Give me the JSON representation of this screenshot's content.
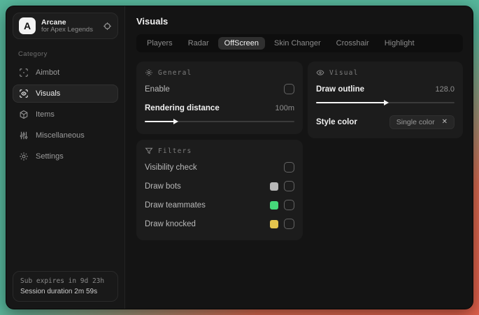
{
  "colors": {
    "bg_teal": "#57b79c",
    "bg_red": "#e2604b",
    "swatch_bots": "#b8b8b8",
    "swatch_teammates": "#46d97a",
    "swatch_knocked": "#e3c44d"
  },
  "sidebar": {
    "brand": {
      "logo_letter": "A",
      "name": "Arcane",
      "subtitle": "for Apex Legends"
    },
    "category_label": "Category",
    "items": [
      {
        "label": "Aimbot"
      },
      {
        "label": "Visuals"
      },
      {
        "label": "Items"
      },
      {
        "label": "Miscellaneous"
      },
      {
        "label": "Settings"
      }
    ],
    "footer": {
      "line1": "Sub expires in 9d 23h",
      "line2": "Session duration 2m 59s"
    }
  },
  "main": {
    "title": "Visuals",
    "tabs": [
      {
        "label": "Players"
      },
      {
        "label": "Radar"
      },
      {
        "label": "OffScreen"
      },
      {
        "label": "Skin Changer"
      },
      {
        "label": "Crosshair"
      },
      {
        "label": "Highlight"
      }
    ],
    "active_tab": "OffScreen",
    "panels": {
      "general": {
        "title": "General",
        "enable_label": "Enable",
        "rendering_distance_label": "Rendering distance",
        "rendering_distance_value": "100m",
        "rendering_distance_fill_percent": 20
      },
      "filters": {
        "title": "Filters",
        "rows": [
          {
            "label": "Visibility check"
          },
          {
            "label": "Draw bots",
            "swatch": "#b8b8b8"
          },
          {
            "label": "Draw teammates",
            "swatch": "#46d97a"
          },
          {
            "label": "Draw knocked",
            "swatch": "#e3c44d"
          }
        ]
      },
      "visual": {
        "title": "Visual",
        "draw_outline_label": "Draw outline",
        "draw_outline_value": "128.0",
        "draw_outline_fill_percent": 50,
        "style_color_label": "Style color",
        "style_color_chip": "Single color",
        "chip_close_glyph": "✕"
      }
    }
  }
}
